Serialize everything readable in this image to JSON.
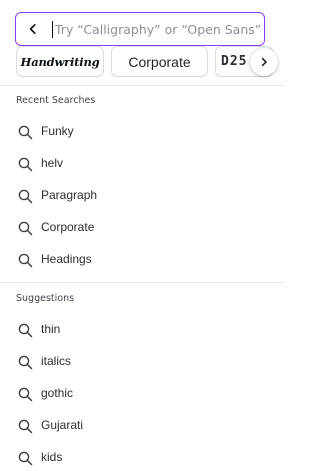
{
  "search": {
    "placeholder": "Try “Calligraphy” or “Open Sans”",
    "value": ""
  },
  "chips": [
    {
      "label": "Handwriting"
    },
    {
      "label": "Corporate"
    },
    {
      "label": "D25"
    }
  ],
  "recent": {
    "title": "Recent Searches",
    "items": [
      "Funky",
      "helv",
      "Paragraph",
      "Corporate",
      "Headings"
    ]
  },
  "suggestions": {
    "title": "Suggestions",
    "items": [
      "thin",
      "italics",
      "gothic",
      "Gujarati",
      "kids"
    ]
  },
  "colors": {
    "accent": "#8b3dff",
    "text": "#0d1216",
    "divider": "#e3e5e8"
  },
  "icons": {
    "back": "chevron-left-icon",
    "next": "chevron-right-icon",
    "search": "search-icon"
  }
}
